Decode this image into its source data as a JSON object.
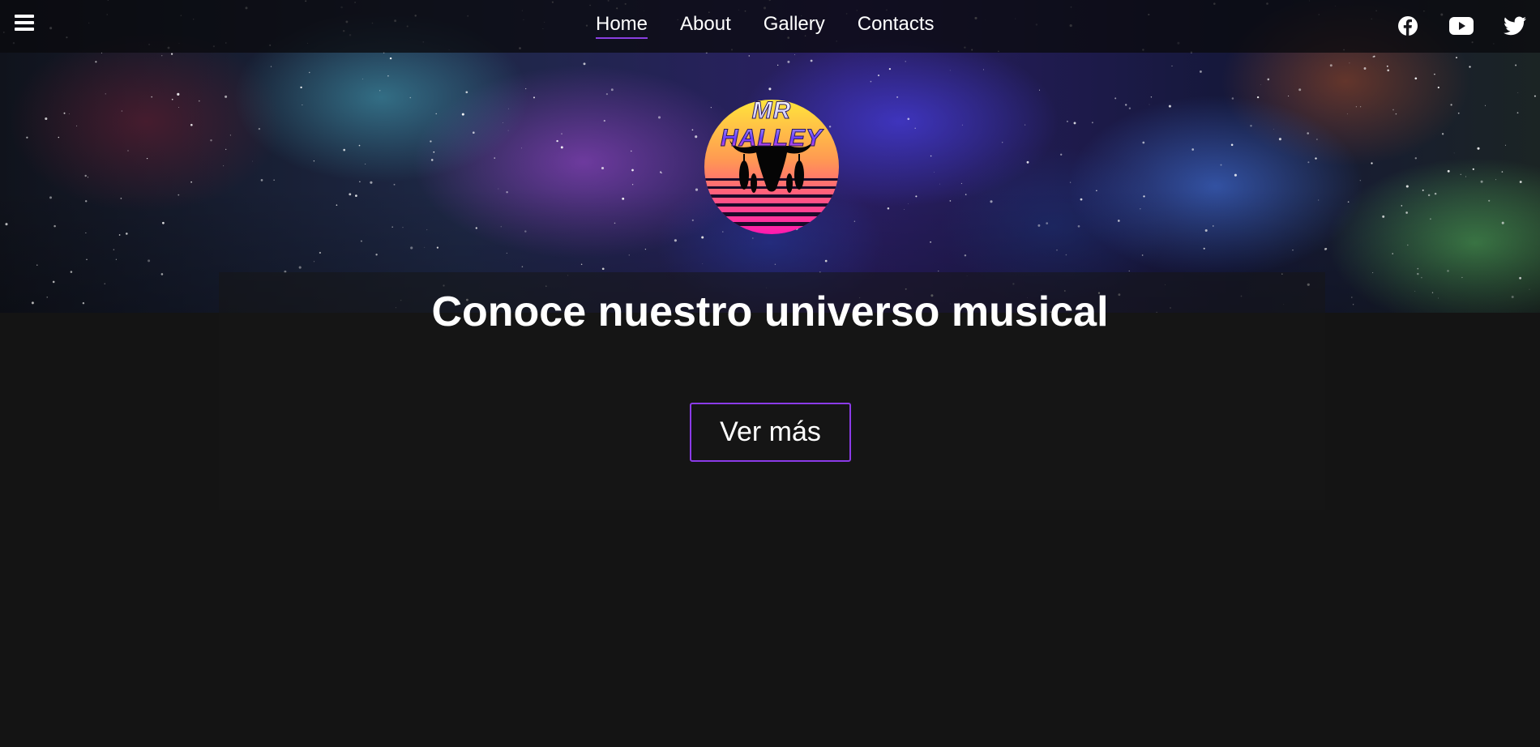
{
  "nav": {
    "menu_icon": "hamburger-icon",
    "links": [
      {
        "label": "Home",
        "active": true
      },
      {
        "label": "About",
        "active": false
      },
      {
        "label": "Gallery",
        "active": false
      },
      {
        "label": "Contacts",
        "active": false
      }
    ],
    "social": [
      {
        "icon": "facebook-icon"
      },
      {
        "icon": "youtube-icon"
      },
      {
        "icon": "twitter-icon"
      }
    ]
  },
  "hero": {
    "logo_text": "MR HALLEY",
    "headline": "Conoce nuestro universo musical",
    "cta_label": "Ver más"
  },
  "colors": {
    "accent": "#8b3be8",
    "background": "#141414",
    "sun_top": "#ffe23a",
    "sun_bottom": "#ff1fae"
  }
}
